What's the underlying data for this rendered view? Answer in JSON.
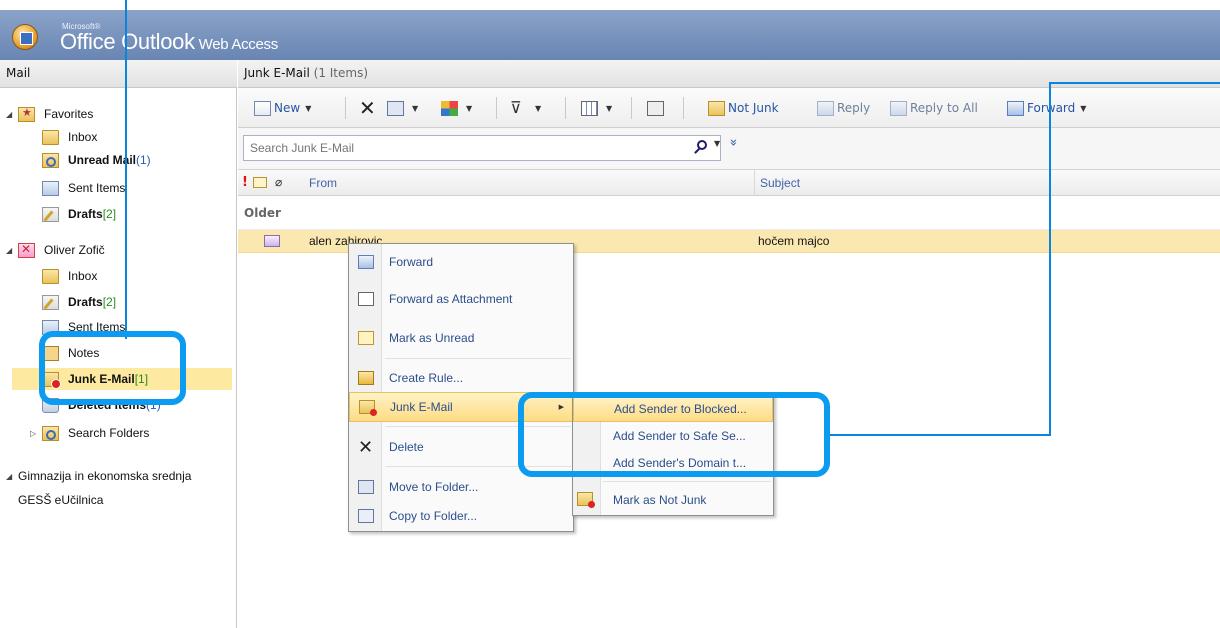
{
  "header": {
    "brand_small": "Microsoft®",
    "brand_office": "Office Outlook",
    "brand_web": " Web Access"
  },
  "nav": {
    "title": "Mail",
    "favorites": {
      "label": "Favorites",
      "items": [
        {
          "label": "Inbox",
          "count": ""
        },
        {
          "label": "Unread Mail",
          "count": "(1)"
        },
        {
          "label": "Sent Items",
          "count": ""
        },
        {
          "label": "Drafts",
          "count": "[2]"
        }
      ]
    },
    "mailbox": {
      "label": "Oliver Zofič",
      "items": [
        {
          "label": "Inbox",
          "count": ""
        },
        {
          "label": "Drafts",
          "count": "[2]"
        },
        {
          "label": "Sent Items",
          "count": ""
        },
        {
          "label": "Notes",
          "count": ""
        },
        {
          "label": "Junk E-Mail",
          "count": "[1]"
        },
        {
          "label": "Deleted Items",
          "count": "(1)"
        },
        {
          "label": "Search Folders",
          "count": ""
        }
      ]
    },
    "other": [
      {
        "label": "Gimnazija in ekonomska srednja"
      },
      {
        "label": "GESŠ eUčilnica"
      }
    ]
  },
  "main": {
    "title": "Junk E-Mail",
    "item_count": "(1 Items)",
    "toolbar": {
      "new_label": "New",
      "not_junk_label": "Not Junk",
      "reply_label": "Reply",
      "reply_all_label": "Reply to All",
      "forward_label": "Forward"
    },
    "search": {
      "placeholder": "Search Junk E-Mail"
    },
    "columns": {
      "from": "From",
      "subject": "Subject"
    },
    "group_label": "Older",
    "messages": [
      {
        "from": "alen zahirovic",
        "subject": "hočem majco"
      }
    ]
  },
  "context_menu": {
    "items": [
      "Forward",
      "Forward as Attachment",
      "Mark as Unread",
      "Create Rule...",
      "Junk E-Mail",
      "Delete",
      "Move to Folder...",
      "Copy to Folder..."
    ]
  },
  "submenu": {
    "items": [
      "Add Sender to Blocked...",
      "Add Sender to Safe Se...",
      "Add Sender's Domain t...",
      "Mark as Not Junk"
    ]
  },
  "colors": {
    "annotation": "#0b9bf0",
    "header": "#7892bd",
    "selection": "#fbe8b0"
  }
}
